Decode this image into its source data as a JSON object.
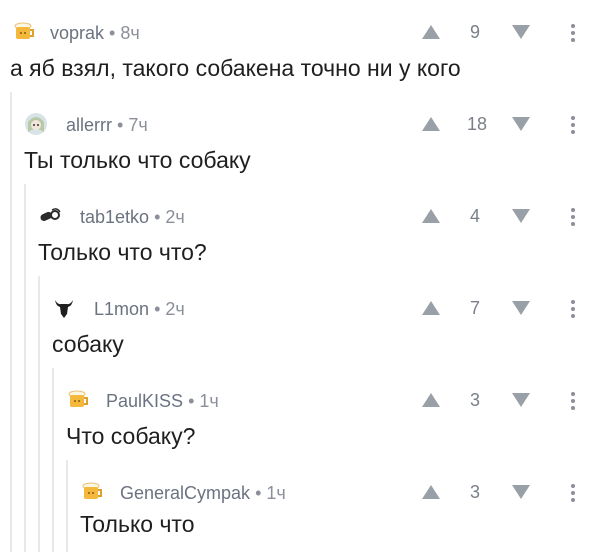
{
  "comments": [
    {
      "author": "voprak",
      "time": "• 8ч",
      "rating": "9",
      "text": "а яб взял, такого собакена точно ни у кого",
      "avatar_icon": "beer-mug-icon"
    },
    {
      "author": "allerrr",
      "time": "• 7ч",
      "rating": "18",
      "text": "Ты только что собаку",
      "avatar_icon": "anime-girl-avatar-icon"
    },
    {
      "author": "tab1etko",
      "time": "• 2ч",
      "rating": "4",
      "text": "Только что что?",
      "avatar_icon": "pills-icon"
    },
    {
      "author": "L1mon",
      "time": "• 2ч",
      "rating": "7",
      "text": "собаку",
      "avatar_icon": "bull-head-icon"
    },
    {
      "author": "PaulKISS",
      "time": "• 1ч",
      "rating": "3",
      "text": "Что собаку?",
      "avatar_icon": "beer-mug-icon"
    },
    {
      "author": "GeneralCympak",
      "time": "• 1ч",
      "rating": "3",
      "text": "Только что",
      "avatar_icon": "beer-mug-icon"
    }
  ],
  "colors": {
    "text": "#1f1f1f",
    "meta": "#8a8f99",
    "vote": "#9aa0a8",
    "thread_line": "#e8e8e8"
  }
}
